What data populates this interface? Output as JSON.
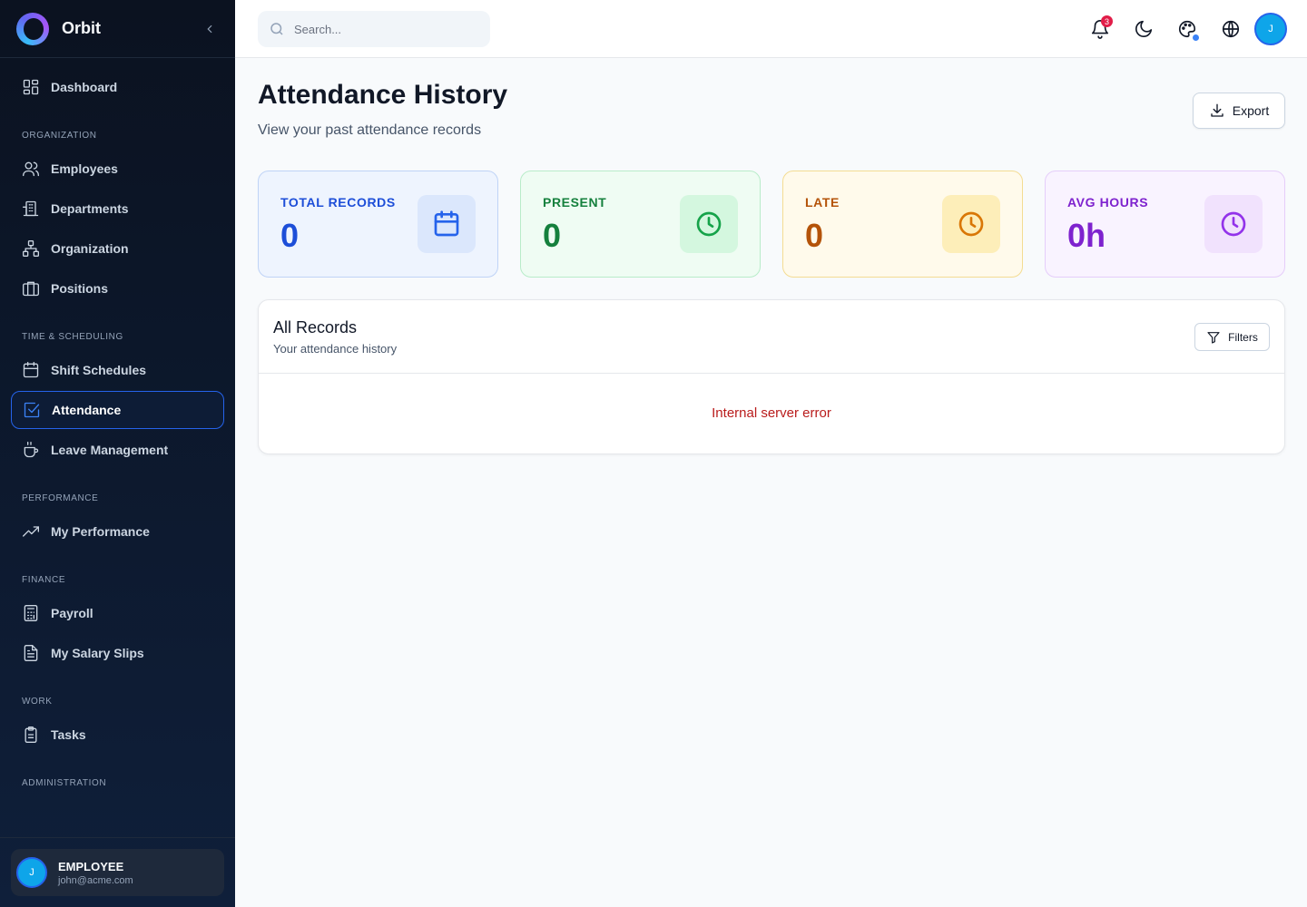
{
  "brand": {
    "name": "Orbit"
  },
  "sidebar": {
    "dashboard": "Dashboard",
    "sections": {
      "organization": "ORGANIZATION",
      "time": "TIME & SCHEDULING",
      "performance": "PERFORMANCE",
      "finance": "FINANCE",
      "work": "WORK",
      "administration": "ADMINISTRATION"
    },
    "items": {
      "employees": "Employees",
      "departments": "Departments",
      "organization": "Organization",
      "positions": "Positions",
      "shift_schedules": "Shift Schedules",
      "attendance": "Attendance",
      "leave": "Leave Management",
      "my_performance": "My Performance",
      "payroll": "Payroll",
      "salary_slips": "My Salary Slips",
      "tasks": "Tasks"
    },
    "active": "attendance",
    "user": {
      "initial": "J",
      "role": "EMPLOYEE",
      "email": "john@acme.com"
    }
  },
  "header": {
    "search_placeholder": "Search...",
    "notification_count": "3",
    "avatar_initial": "J"
  },
  "page": {
    "title": "Attendance History",
    "subtitle": "View your past attendance records",
    "export_label": "Export"
  },
  "stats": {
    "total": {
      "label": "TOTAL RECORDS",
      "value": "0"
    },
    "present": {
      "label": "PRESENT",
      "value": "0"
    },
    "late": {
      "label": "LATE",
      "value": "0"
    },
    "avg_hours": {
      "label": "AVG HOURS",
      "value": "0h"
    }
  },
  "records": {
    "title": "All Records",
    "subtitle": "Your attendance history",
    "filters_label": "Filters",
    "error": "Internal server error"
  },
  "colors": {
    "accent": "#2563eb",
    "sidebar_bg": "#0b1220",
    "error": "#b91c1c"
  }
}
